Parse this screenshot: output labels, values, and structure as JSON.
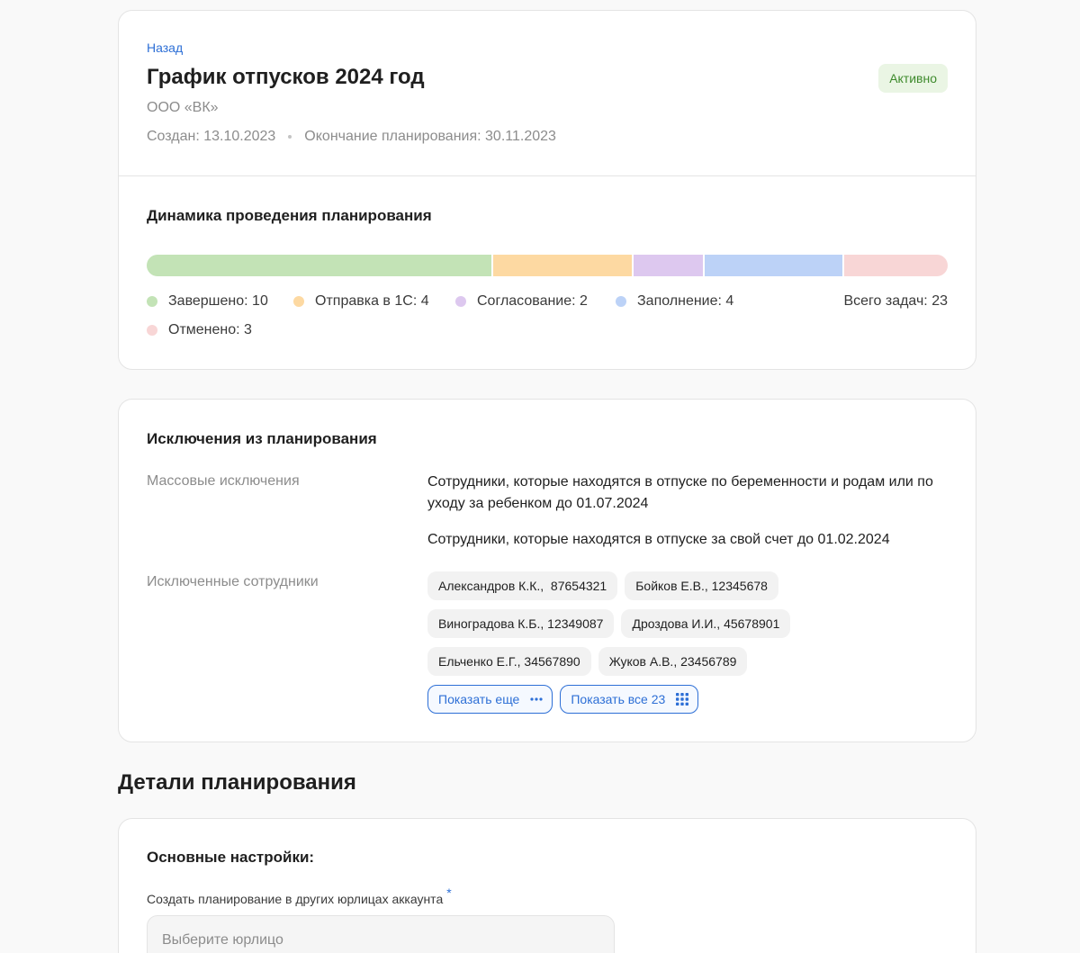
{
  "header": {
    "back_label": "Назад",
    "title": "График отпусков 2024 год",
    "status": "Активно",
    "organization": "ООО «ВК»",
    "created": "Создан: 13.10.2023",
    "planning_end": "Окончание планирования: 30.11.2023"
  },
  "dynamics": {
    "title": "Динамика проведения планирования",
    "total_label": "Всего задач: 23",
    "total": 23,
    "segments": [
      {
        "label": "Завершено: 10",
        "value": 10,
        "color": "#c3e3b6"
      },
      {
        "label": "Отправка в 1С: 4",
        "value": 4,
        "color": "#fdd9a2"
      },
      {
        "label": "Согласование: 2",
        "value": 2,
        "color": "#ddc8ef"
      },
      {
        "label": "Заполнение: 4",
        "value": 4,
        "color": "#bcd2f7"
      },
      {
        "label": "Отменено: 3",
        "value": 3,
        "color": "#f8d6d6"
      }
    ]
  },
  "exclusions": {
    "title": "Исключения из планирования",
    "mass_label": "Массовые исключения",
    "mass_items": [
      "Сотрудники, которые находятся в отпуске по беременности и родам или по уходу за ребенком до 01.07.2024",
      "Сотрудники, которые находятся в отпуске за свой счет до 01.02.2024"
    ],
    "employees_label": "Исключенные сотрудники",
    "employees": [
      "Александров К.К.,  87654321",
      "Бойков Е.В., 12345678",
      "Виноградова К.Б., 12349087",
      "Дроздова И.И., 45678901",
      "Ельченко Е.Г., 34567890",
      "Жуков А.В., 23456789"
    ],
    "show_more_label": "Показать еще",
    "show_all_label": "Показать все 23"
  },
  "details": {
    "heading": "Детали планирования",
    "settings_title": "Основные настройки:",
    "field_label": "Создать планирование в других юрлицах аккаунта",
    "required_mark": "*",
    "select_placeholder": "Выберите юрлицо"
  },
  "colors": {
    "accent": "#2d6fd6",
    "status_bg": "#eaf5e4",
    "status_text": "#3e8a2c"
  }
}
